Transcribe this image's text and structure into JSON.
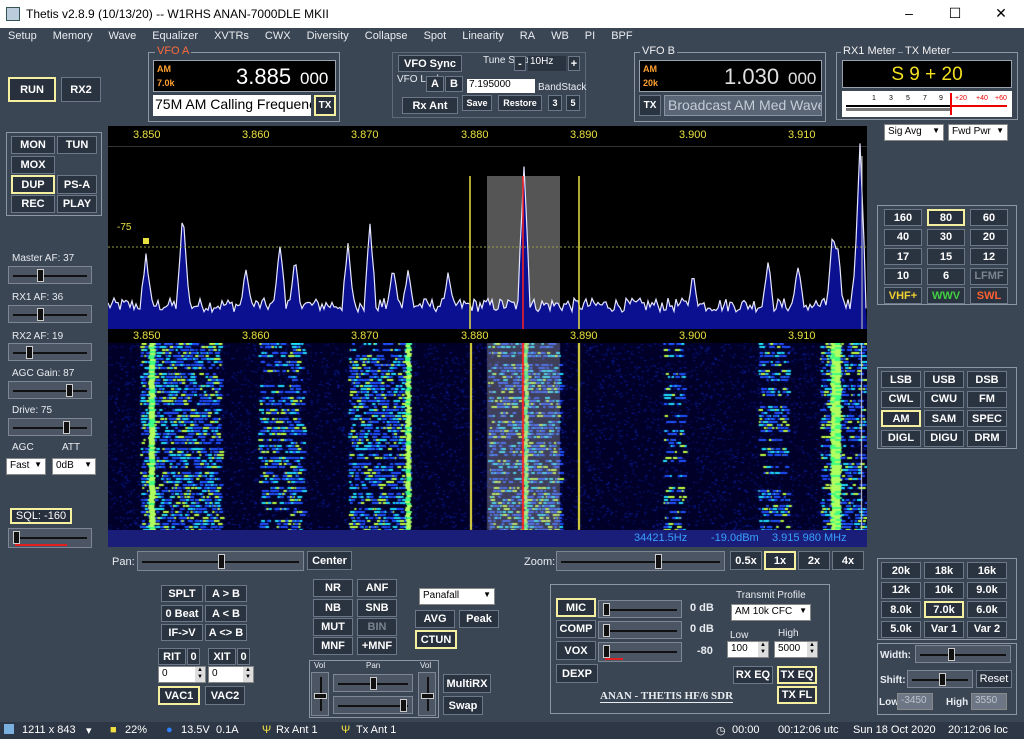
{
  "window": {
    "title": "Thetis v2.8.9 (10/13/20)    --    W1RHS ANAN-7000DLE MKII",
    "min": "–",
    "max": "☐",
    "close": "✕"
  },
  "menu": [
    "Setup",
    "Memory",
    "Wave",
    "Equalizer",
    "XVTRs",
    "CWX",
    "Diversity",
    "Collapse",
    "Spot",
    "Linearity",
    "RA",
    "WB",
    "PI",
    "BPF"
  ],
  "run": {
    "run": "RUN",
    "rx2": "RX2"
  },
  "vfoA": {
    "label": "VFO A",
    "mode": "AM",
    "filter": "7.0k",
    "freq": "3.885",
    "freq_fine": "000",
    "desc": "75M AM Calling Frequenc",
    "tx": "TX"
  },
  "vfoSync": {
    "sync": "VFO Sync",
    "tune_step_label": "Tune Step:",
    "tune_step": "10Hz",
    "minus": "-",
    "plus": "+",
    "lock_label": "VFO Lock:",
    "a": "A",
    "b": "B",
    "lock_freq": "7.195000",
    "bandstack": "BandStack",
    "rx_ant": "Rx Ant",
    "save": "Save",
    "restore": "Restore",
    "bs3": "3",
    "bs5": "5"
  },
  "vfoB": {
    "label": "VFO B",
    "mode": "AM",
    "filter": "20k",
    "freq": "1.030",
    "freq_fine": "000",
    "tx": "TX",
    "desc": "Broadcast AM Med Wave"
  },
  "meter": {
    "rx_label": "RX1 Meter",
    "tx_label": "TX Meter",
    "reading": "S 9 + 20",
    "scale": [
      "1",
      "3",
      "5",
      "7",
      "9",
      "+20",
      "+40",
      "+60"
    ],
    "rx_mode": "Sig Avg",
    "tx_mode": "Fwd Pwr"
  },
  "left": {
    "mon": "MON",
    "tun": "TUN",
    "mox": "MOX",
    "dup": "DUP",
    "psa": "PS-A",
    "rec": "REC",
    "play": "PLAY",
    "master_af": "Master AF:  37",
    "rx1_af": "RX1 AF:  36",
    "rx2_af": "RX2 AF:  19",
    "agc_gain": "AGC Gain:  87",
    "drive": "Drive:  75",
    "agc": "AGC",
    "att": "ATT",
    "agc_val": "Fast",
    "att_val": "0dB",
    "sql": "SQL:  -160"
  },
  "master_af_level": 0.37,
  "rx1_af_level": 0.36,
  "rx2_af_level": 0.19,
  "agc_gain_level": 0.8,
  "drive_level": 0.75,
  "pan": {
    "ticks": [
      "3.850",
      "3.860",
      "3.870",
      "3.880",
      "3.890",
      "3.900",
      "3.910"
    ],
    "db_label": "-75",
    "colors": {
      "trace": "#e6e6ff",
      "fill": "#0a1090",
      "marker": "#ff2020",
      "filter": "#555",
      "yellow": "#e8e040"
    }
  },
  "wf": {
    "ticks": [
      "3.850",
      "3.860",
      "3.870",
      "3.880",
      "3.890",
      "3.900",
      "3.910"
    ],
    "status_hz": "34421.5Hz",
    "status_dbm": "-19.0dBm",
    "status_mhz": "3.915 980 MHz"
  },
  "bands": [
    "160",
    "80",
    "60",
    "40",
    "30",
    "20",
    "17",
    "15",
    "12",
    "10",
    "6",
    "LFMF",
    "VHF+",
    "WWV",
    "SWL"
  ],
  "modes": [
    "LSB",
    "USB",
    "DSB",
    "CWL",
    "CWU",
    "FM",
    "AM",
    "SAM",
    "SPEC",
    "DIGL",
    "DIGU",
    "DRM"
  ],
  "filters": [
    "20k",
    "18k",
    "16k",
    "12k",
    "10k",
    "9.0k",
    "8.0k",
    "7.0k",
    "6.0k",
    "5.0k",
    "Var 1",
    "Var 2"
  ],
  "filterctl": {
    "width": "Width:",
    "shift": "Shift:",
    "reset": "Reset",
    "low": "Low",
    "high": "High",
    "low_val": "-3450",
    "high_val": "3550"
  },
  "panctl": {
    "pan": "Pan:",
    "center": "Center",
    "zoom": "Zoom:",
    "z05": "0.5x",
    "z1": "1x",
    "z2": "2x",
    "z4": "4x"
  },
  "vfoops": {
    "splt": "SPLT",
    "ab": "A > B",
    "zerobeat": "0 Beat",
    "ba": "A < B",
    "ifv": "IF->V",
    "axb": "A <> B",
    "rit": "RIT",
    "rit_on": "0",
    "xit": "XIT",
    "xit_on": "0",
    "rit_val": "0",
    "xit_val": "0",
    "vac1": "VAC1",
    "vac2": "VAC2"
  },
  "dsp": {
    "nr": "NR",
    "anf": "ANF",
    "nb": "NB",
    "snb": "SNB",
    "mut": "MUT",
    "bin": "BIN",
    "mnf": "MNF",
    "pmnf": "+MNF",
    "display": "Panafall",
    "avg": "AVG",
    "peak": "Peak",
    "ctun": "CTUN"
  },
  "mix": {
    "vol": "Vol",
    "pan": "Pan",
    "vol2": "Vol",
    "multirx": "MultiRX",
    "swap": "Swap"
  },
  "tx": {
    "mic": "MIC",
    "mic_db": "0 dB",
    "comp": "COMP",
    "comp_db": "0 dB",
    "vox": "VOX",
    "vox_val": "-80",
    "dexp": "DEXP",
    "profile_label": "Transmit Profile",
    "profile": "AM 10k CFC",
    "low": "Low",
    "high": "High",
    "low_val": "100",
    "high_val": "5000",
    "rxeq": "RX EQ",
    "txeq": "TX EQ",
    "txfl": "TX FL",
    "logo": "ANAN - THETIS HF/6 SDR"
  },
  "status": {
    "size": "1211 x 843",
    "cpu": "22%",
    "volts": "13.5V",
    "amps": "0.1A",
    "rx_ant": "Rx Ant  1",
    "tx_ant": "Tx Ant  1",
    "timer": "00:00",
    "utc": "00:12:06 utc",
    "date": "Sun 18 Oct 2020",
    "local": "20:12:06 loc"
  }
}
